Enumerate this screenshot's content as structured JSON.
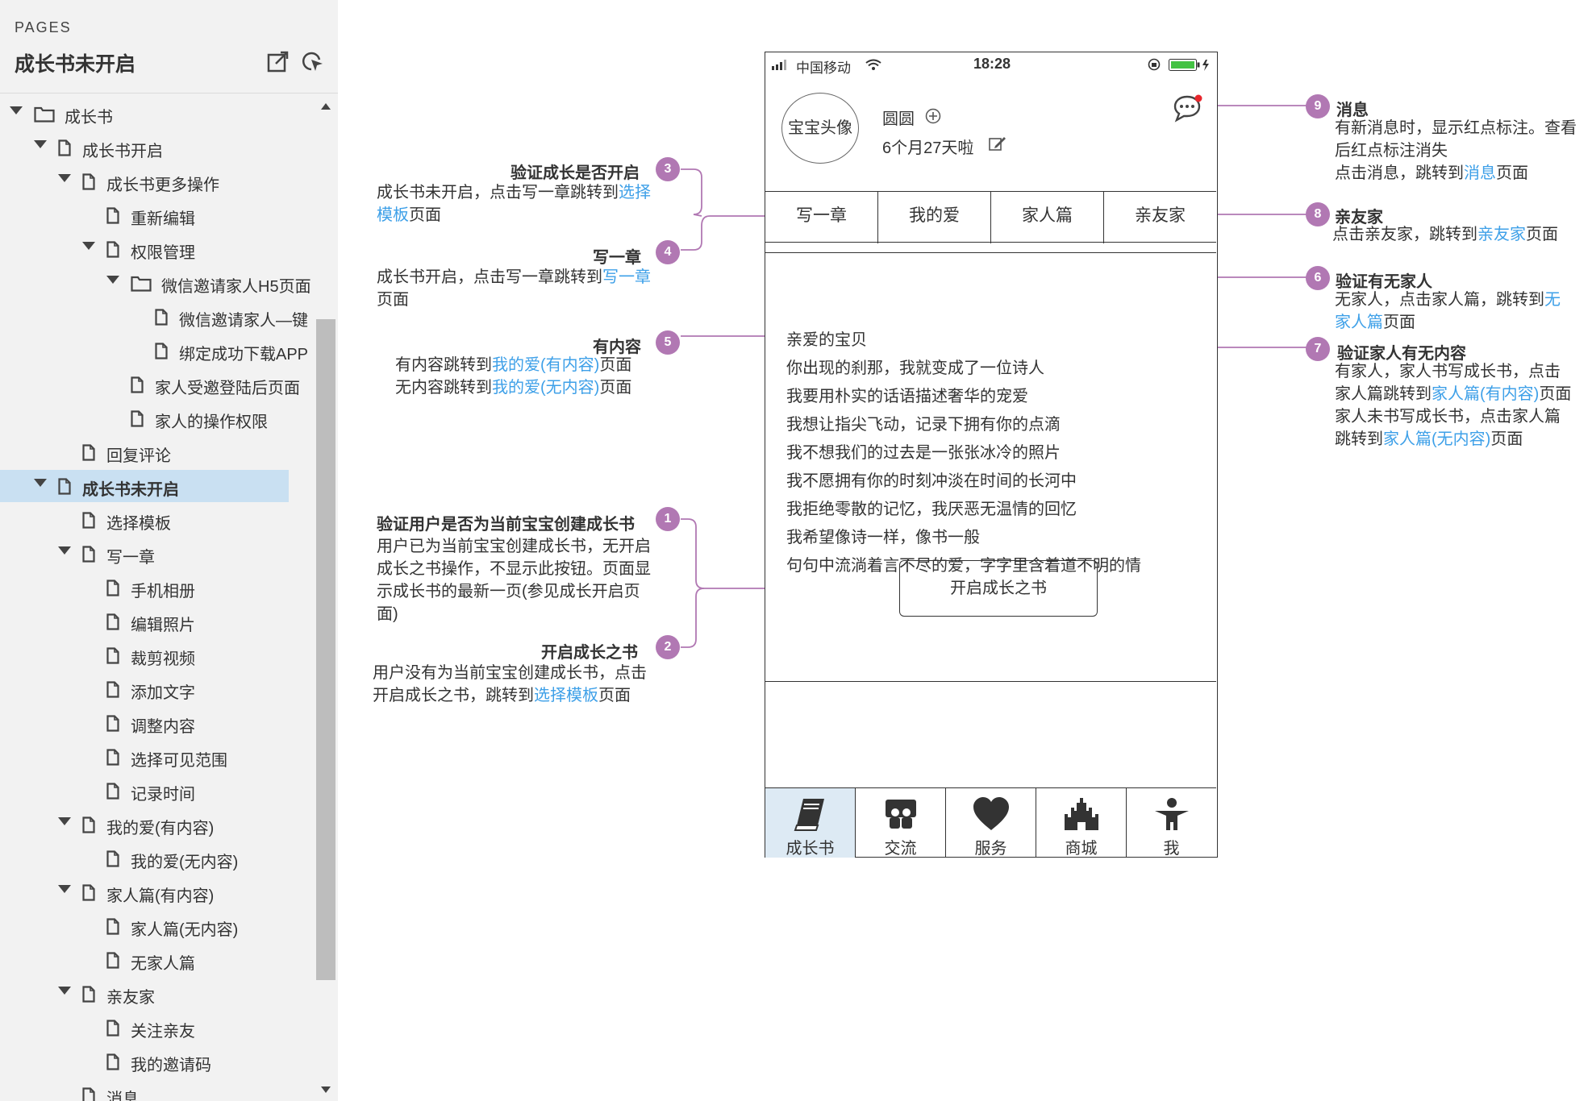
{
  "sidebar": {
    "pages_label": "PAGES",
    "title": "成长书未开启",
    "tree": [
      {
        "label": "成长书",
        "type": "folder",
        "depth": 0,
        "expanded": true
      },
      {
        "label": "成长书开启",
        "type": "page",
        "depth": 1,
        "expanded": true
      },
      {
        "label": "成长书更多操作",
        "type": "page",
        "depth": 2,
        "expanded": true
      },
      {
        "label": "重新编辑",
        "type": "page",
        "depth": 3
      },
      {
        "label": "权限管理",
        "type": "page",
        "depth": 3,
        "expanded": true
      },
      {
        "label": "微信邀请家人H5页面",
        "type": "folder",
        "depth": 4,
        "expanded": true
      },
      {
        "label": "微信邀请家人—键",
        "type": "page",
        "depth": 5
      },
      {
        "label": "绑定成功下载APP",
        "type": "page",
        "depth": 5
      },
      {
        "label": "家人受邀登陆后页面",
        "type": "page",
        "depth": 4
      },
      {
        "label": "家人的操作权限",
        "type": "page",
        "depth": 4
      },
      {
        "label": "回复评论",
        "type": "page",
        "depth": 2
      },
      {
        "label": "成长书未开启",
        "type": "page",
        "depth": 1,
        "expanded": true,
        "selected": true
      },
      {
        "label": "选择模板",
        "type": "page",
        "depth": 2
      },
      {
        "label": "写一章",
        "type": "page",
        "depth": 2,
        "expanded": true
      },
      {
        "label": "手机相册",
        "type": "page",
        "depth": 3
      },
      {
        "label": "编辑照片",
        "type": "page",
        "depth": 3
      },
      {
        "label": "裁剪视频",
        "type": "page",
        "depth": 3
      },
      {
        "label": "添加文字",
        "type": "page",
        "depth": 3
      },
      {
        "label": "调整内容",
        "type": "page",
        "depth": 3
      },
      {
        "label": "选择可见范围",
        "type": "page",
        "depth": 3
      },
      {
        "label": "记录时间",
        "type": "page",
        "depth": 3
      },
      {
        "label": "我的爱(有内容)",
        "type": "page",
        "depth": 2,
        "expanded": true
      },
      {
        "label": "我的爱(无内容)",
        "type": "page",
        "depth": 3
      },
      {
        "label": "家人篇(有内容)",
        "type": "page",
        "depth": 2,
        "expanded": true
      },
      {
        "label": "家人篇(无内容)",
        "type": "page",
        "depth": 3
      },
      {
        "label": "无家人篇",
        "type": "page",
        "depth": 3
      },
      {
        "label": "亲友家",
        "type": "page",
        "depth": 2,
        "expanded": true
      },
      {
        "label": "关注亲友",
        "type": "page",
        "depth": 3
      },
      {
        "label": "我的邀请码",
        "type": "page",
        "depth": 3
      },
      {
        "label": "消息",
        "type": "page",
        "depth": 2
      }
    ]
  },
  "phone": {
    "status": {
      "carrier": "中国移动",
      "time": "18:28"
    },
    "profile": {
      "avatar": "宝宝头像",
      "name": "圆圆",
      "age": "6个月27天啦"
    },
    "tabs": [
      "写一章",
      "我的爱",
      "家人篇",
      "亲友家"
    ],
    "poem": [
      "亲爱的宝贝",
      "你出现的刹那，我就变成了一位诗人",
      "我要用朴实的话语描述奢华的宠爱",
      "我想让指尖飞动，记录下拥有你的点滴",
      "我不想我们的过去是一张张冰冷的照片",
      "我不愿拥有你的时刻冲淡在时间的长河中",
      "我拒绝零散的记忆，我厌恶无温情的回忆",
      "我希望像诗一样，像书一般",
      "句句中流淌着言不尽的爱，字字里含着道不明的情"
    ],
    "open_button": "开启成长之书",
    "nav": [
      {
        "label": "成长书",
        "icon": "book-icon",
        "active": true
      },
      {
        "label": "交流",
        "icon": "chat-group-icon"
      },
      {
        "label": "服务",
        "icon": "heart-icon"
      },
      {
        "label": "商城",
        "icon": "castle-icon"
      },
      {
        "label": "我",
        "icon": "person-icon"
      }
    ]
  },
  "annotations": {
    "a1": {
      "num": "1",
      "title": "验证用户是否为当前宝宝创建成长书",
      "desc": "用户已为当前宝宝创建成长书，无开启成长之书操作，不显示此按钮。页面显示成长书的最新一页(参见成长开启页面)"
    },
    "a2": {
      "num": "2",
      "title": "开启成长之书",
      "d1": "用户没有为当前宝宝创建成长书，点击开启成长之书，跳转到",
      "link": "选择模板",
      "d2": "页面"
    },
    "a3": {
      "num": "3",
      "title": "验证成长是否开启",
      "d1": "成长书未开启，点击写一章跳转到",
      "link": "选择模板",
      "d2": "页面"
    },
    "a4": {
      "num": "4",
      "title": "写一章",
      "d1": "成长书开启，点击写一章跳转到",
      "link": "写一章",
      "d2": "页面"
    },
    "a5": {
      "num": "5",
      "title": "有内容",
      "l1a": "有内容跳转到",
      "l1link": "我的爱(有内容)",
      "l1b": "页面",
      "l2a": "无内容跳转到",
      "l2link": "我的爱(无内容)",
      "l2b": "页面"
    },
    "a6": {
      "num": "6",
      "title": "验证有无家人",
      "d1": "无家人，点击家人篇，跳转到",
      "link": "无家人篇",
      "d2": "页面"
    },
    "a7": {
      "num": "7",
      "title": "验证家人有无内容",
      "p1a": "有家人，家人书写成长书，点击家人篇跳转到",
      "p1link": "家人篇(有内容)",
      "p1b": "页面",
      "p2a": "家人未书写成长书，点击家人篇跳转到",
      "p2link": "家人篇(无内容)",
      "p2b": "页面"
    },
    "a8": {
      "num": "8",
      "title": "亲友家",
      "d1": "点击亲友家，跳转到",
      "link": "亲友家",
      "d2": "页面"
    },
    "a9": {
      "num": "9",
      "title": "消息",
      "d1": "有新消息时，显示红点标注。查看后红点标注消失",
      "d2": "点击消息，跳转到",
      "link": "消息",
      "d3": "页面"
    }
  },
  "colors": {
    "connector": "#b178b3",
    "link": "#3ea0e8",
    "selected_row": "#c9e0f2",
    "notification_dot": "#e8262c",
    "battery": "#43c243"
  }
}
